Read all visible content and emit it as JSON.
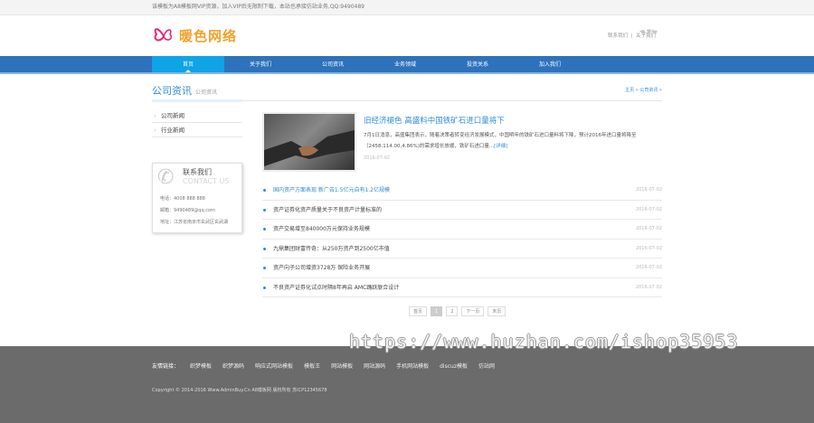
{
  "topbar": {
    "notice": "该模板为A8模板网VIP资源，加入VIP后无限制下载，本站也承接仿站业务,QQ:9490489"
  },
  "header": {
    "logo_text": "暖色网络",
    "links": [
      "联系我们",
      "关于我们"
    ]
  },
  "nav": [
    "首页",
    "关于我们",
    "公司资讯",
    "业务领域",
    "投资关系",
    "加入我们"
  ],
  "page": {
    "title": "公司资讯",
    "subtitle": "公司资讯",
    "breadcrumb": "主页 » 公司资讯 »"
  },
  "sidebar": {
    "items": [
      "公司新闻",
      "行业新闻"
    ],
    "contact": {
      "title": "联系我们",
      "title_en": "CONTACT US",
      "phone": "电话：4008 888 888",
      "email": "邮箱：9490489@qq.com",
      "address": "地址：江苏省南京市玄武区玄武湖"
    }
  },
  "featured": {
    "title": "旧经济褪色 高盛料中国铁矿石进口量将下",
    "desc": "7月1日消息，高盛集团表示，随着决策者转变经济发展模式，中国明年的铁矿石进口量料将下降，预计2016年进口量将降至（2458,114.00,4.86%)的需求增长放缓，铁矿石进口量...",
    "more": "[详细]",
    "date": "2016-07-02"
  },
  "news": [
    {
      "title": "国内资产方面表现 新广告1.5亿元自有1.2亿规模",
      "date": "2016-07-02"
    },
    {
      "title": "资产证券化资产质量关于不良资产计量标准的",
      "date": "2016-07-02"
    },
    {
      "title": "资产交易增至840000万元保持业务规模",
      "date": "2016-07-02"
    },
    {
      "title": "九鼎集团财富传奇：从250万资产到2500亿市值",
      "date": "2016-07-02"
    },
    {
      "title": "资产向子公司增资3728万 保险业务开展",
      "date": "2016-07-02"
    },
    {
      "title": "不良资产证券化试点时隔8年再启 AMC踊跃联合设计",
      "date": "2016-07-02"
    }
  ],
  "pager": [
    "首页",
    "1",
    "2",
    "下一页",
    "末页"
  ],
  "footer": {
    "links_label": "友情链接：",
    "links": [
      "织梦模板",
      "织梦源码",
      "响应式网站模板",
      "模板王",
      "网站模板",
      "网站源码",
      "手机网站模板",
      "discuz模板",
      "仿站网"
    ],
    "copyright": "Copyright © 2014-2016 Www.AdminBuy.Cn A8模板网 版权所有 苏ICP12345678"
  },
  "watermark": "https://www.huzhan.com/ishop35953"
}
